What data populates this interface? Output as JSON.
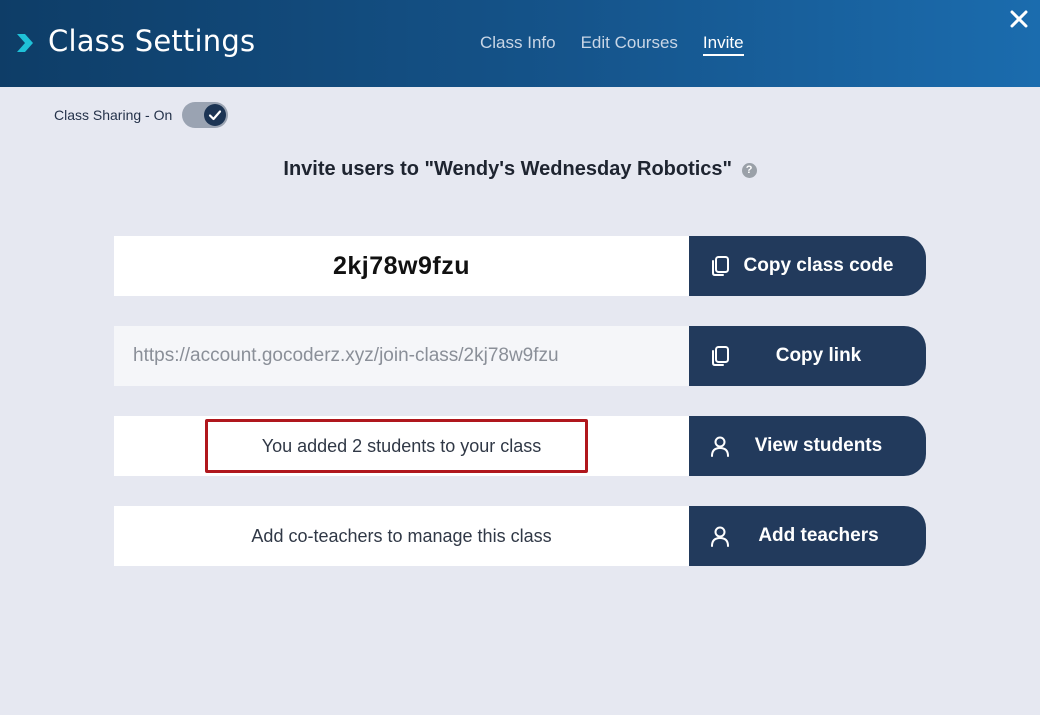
{
  "header": {
    "title": "Class Settings",
    "tabs": [
      {
        "label": "Class Info",
        "active": false
      },
      {
        "label": "Edit Courses",
        "active": false
      },
      {
        "label": "Invite",
        "active": true
      }
    ]
  },
  "sharing": {
    "label": "Class Sharing - On",
    "enabled": true
  },
  "invite": {
    "heading": "Invite users to \"Wendy's Wednesday Robotics\"",
    "help_icon": "?",
    "class_code": "2kj78w9fzu",
    "copy_code_label": "Copy class code",
    "link": "https://account.gocoderz.xyz/join-class/2kj78w9fzu",
    "copy_link_label": "Copy link",
    "students_message": "You added 2 students to your class",
    "view_students_label": "View students",
    "teachers_message": "Add co-teachers to manage this class",
    "add_teachers_label": "Add teachers"
  },
  "colors": {
    "header_start": "#0e3d67",
    "header_end": "#1b6cae",
    "button": "#223a5c",
    "background": "#e6e8f1",
    "highlight": "#b0171d",
    "chevron": "#1fc1d8"
  },
  "icons": [
    "chevron-right-icon",
    "close-icon",
    "check-icon",
    "help-icon",
    "copy-icon",
    "user-icon"
  ]
}
